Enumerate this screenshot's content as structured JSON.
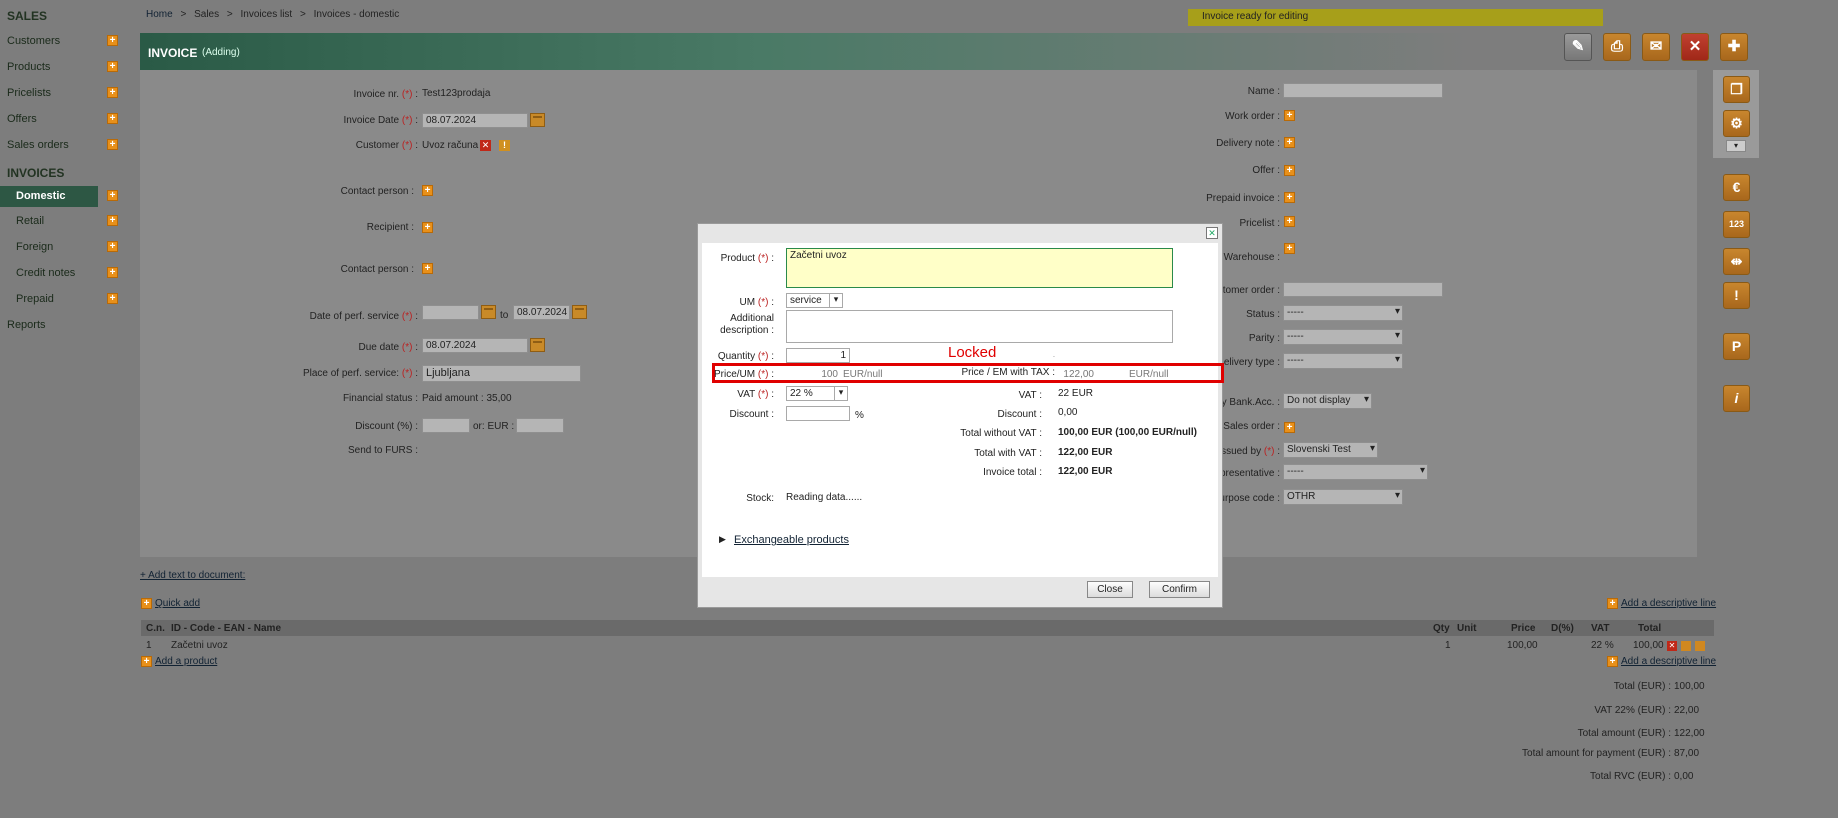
{
  "sidebar": {
    "title": "SALES",
    "items": [
      {
        "label": "Customers"
      },
      {
        "label": "Products"
      },
      {
        "label": "Pricelists"
      },
      {
        "label": "Offers"
      },
      {
        "label": "Sales orders"
      }
    ],
    "invoices_title": "INVOICES",
    "invoice_items": [
      {
        "label": "Domestic",
        "active": true
      },
      {
        "label": "Retail"
      },
      {
        "label": "Foreign"
      },
      {
        "label": "Credit notes"
      },
      {
        "label": "Prepaid"
      }
    ],
    "reports": "Reports"
  },
  "breadcrumb": {
    "items": [
      "Home",
      "Sales",
      "Invoices list",
      "Invoices - domestic"
    ],
    "separator": ">"
  },
  "notice": "Invoice ready for editing",
  "header": {
    "title": "INVOICE",
    "subtitle": "(Adding)"
  },
  "form_left": {
    "invoice_nr_label": "Invoice nr.",
    "invoice_nr": "Test123prodaja",
    "invoice_date_label": "Invoice Date",
    "invoice_date": "08.07.2024",
    "customer_label": "Customer",
    "customer": "Uvoz računa",
    "contact_person_label": "Contact person :",
    "recipient_label": "Recipient :",
    "contact_person2_label": "Contact person :",
    "perf_date_label": "Date of perf. service",
    "perf_date_to_word": "to",
    "perf_date_to": "08.07.2024",
    "due_date_label": "Due date",
    "due_date": "08.07.2024",
    "place_label": "Place of perf. service:",
    "place": "Ljubljana",
    "financial_label": "Financial status :",
    "financial_value": "Paid amount : 35,00",
    "discount_label": "Discount (%) :",
    "discount_or": "or: EUR :",
    "furs_label": "Send to FURS :",
    "required_mark": "(*)",
    "colon": ":"
  },
  "form_right": {
    "name_label": "Name :",
    "work_order_label": "Work order :",
    "delivery_note_label": "Delivery note :",
    "offer_label": "Offer :",
    "prepaid_label": "Prepaid invoice :",
    "pricelist_label": "Pricelist :",
    "warehouse_label": "Warehouse :",
    "customer_order_label": "tomer order :",
    "status_label": "Status :",
    "status": "-----",
    "parity_label": "Parity :",
    "parity": "-----",
    "delivery_type_label": "elivery type :",
    "delivery_type": "-----",
    "bank_label": "y Bank.Acc. :",
    "bank": "Do not display",
    "sales_order_label": "Sales order :",
    "issued_label": "ssued by",
    "issued": "Slovenski Test",
    "representative_label": "presentative :",
    "representative": "-----",
    "purpose_label": "urpose code :",
    "purpose": "OTHR"
  },
  "modal": {
    "product_label": "Product",
    "product": "Začetni uvoz",
    "um_label": "UM",
    "um": "service",
    "additional_label_1": "Additional",
    "additional_label_2": "description :",
    "quantity_label": "Quantity",
    "quantity": "1",
    "locked_note": "Locked",
    "price_label": "Price/UM",
    "price": "100",
    "price_unit": "EUR/null",
    "price_tax_label": "Price / EM with TAX :",
    "price_tax": "122,00",
    "price_tax_unit": "EUR/null",
    "vat_label": "VAT",
    "vat": "22 %",
    "discount_label": "Discount :",
    "discount_unit": "%",
    "vat_r_label": "VAT :",
    "vat_r": "22 EUR",
    "discount_r_label": "Discount :",
    "discount_r": "0,00",
    "total_wo_vat_label": "Total without VAT :",
    "total_wo_vat": "100,00 EUR (100,00 EUR/null)",
    "total_w_vat_label": "Total with VAT :",
    "total_w_vat": "122,00 EUR",
    "invoice_total_label": "Invoice total :",
    "invoice_total": "122,00 EUR",
    "stock_label": "Stock:",
    "stock": "Reading data......",
    "exchangeable": "Exchangeable products",
    "close": "Close",
    "confirm": "Confirm",
    "highlight_color": "#e00000"
  },
  "lower": {
    "add_text": "+ Add text to document:",
    "quick_add": "Quick add",
    "add_descriptive": "Add a descriptive line",
    "add_product": "Add a product",
    "add_descriptive2": "Add a descriptive line",
    "columns": [
      "C.n.",
      "ID - Code - EAN - Name",
      "Qty",
      "Unit",
      "Price",
      "D(%)",
      "VAT",
      "Total"
    ],
    "row": {
      "cn": "1",
      "name": "Začetni uvoz",
      "qty": "1",
      "unit": "",
      "price": "100,00",
      "disc": "",
      "vat": "22 %",
      "total": "100,00"
    }
  },
  "totals": [
    {
      "label": "Total (EUR) :",
      "value": "100,00"
    },
    {
      "label": "VAT 22% (EUR) :",
      "value": "22,00"
    },
    {
      "label": "Total amount (EUR) :",
      "value": "122,00"
    },
    {
      "label": "Total amount for payment (EUR) :",
      "value": "87,00"
    },
    {
      "label": "Total RVC (EUR) :",
      "value": "0,00"
    }
  ]
}
